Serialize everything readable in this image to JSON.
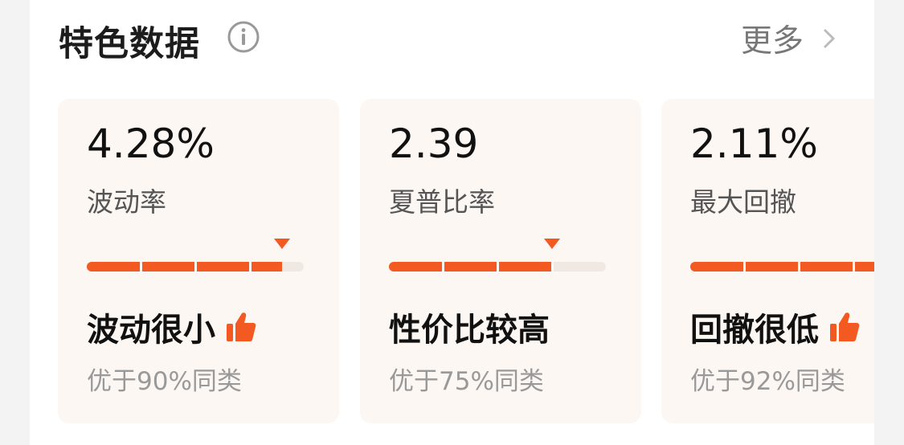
{
  "header": {
    "title": "特色数据",
    "more_label": "更多"
  },
  "colors": {
    "accent": "#f25a22",
    "card_bg": "#fdf7f3",
    "track": "#efe8e3"
  },
  "cards": [
    {
      "value": "4.28%",
      "label": "波动率",
      "verdict": "波动很小",
      "has_thumb": true,
      "compare": "优于90%同类",
      "percentile": 0.9
    },
    {
      "value": "2.39",
      "label": "夏普比率",
      "verdict": "性价比较高",
      "has_thumb": false,
      "compare": "优于75%同类",
      "percentile": 0.75
    },
    {
      "value": "2.11%",
      "label": "最大回撤",
      "verdict": "回撤很低",
      "has_thumb": true,
      "compare": "优于92%同类",
      "percentile": 0.92
    }
  ]
}
